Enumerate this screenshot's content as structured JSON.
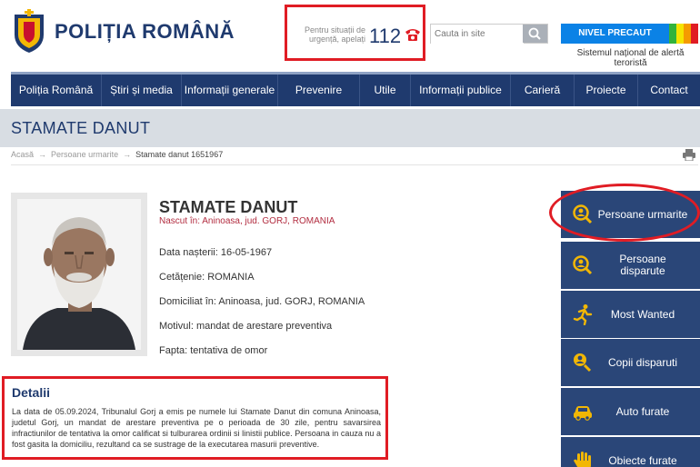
{
  "header": {
    "brand": "POLIȚIA ROMÂNĂ",
    "emergency_text": "Pentru situații de urgență, apelați",
    "emergency_number": "112",
    "search_placeholder": "Cauta in site",
    "alert_label": "NIVEL PRECAUT",
    "alert_caption": "Sistemul național de alertă teroristă",
    "alert_colors": [
      "#0b82e6",
      "#33b33b",
      "#f5e400",
      "#f59b00",
      "#e01c24"
    ]
  },
  "nav": [
    "Poliția Română",
    "Știri și media",
    "Informații generale",
    "Prevenire",
    "Utile",
    "Informații publice",
    "Carieră",
    "Proiecte",
    "Contact"
  ],
  "page_title": "STAMATE DANUT",
  "breadcrumb": {
    "home": "Acasă",
    "section": "Persoane urmarite",
    "current": "Stamate danut 1651967",
    "separator": "→"
  },
  "person": {
    "name": "STAMATE DANUT",
    "born": "Nascut în: Aninoasa, jud. GORJ, ROMANIA",
    "fields": [
      "Data nașterii: 16-05-1967",
      "Cetățenie: ROMANIA",
      "Domiciliat în: Aninoasa, jud. GORJ, ROMANIA",
      "Motivul: mandat de arestare preventiva",
      "Fapta: tentativa de omor"
    ]
  },
  "details": {
    "heading": "Detalii",
    "text": "La data de 05.09.2024, Tribunalul Gorj a emis pe numele lui Stamate Danut din comuna Aninoasa, judetul Gorj, un mandat de arestare preventiva pe o perioada de 30 zile, pentru savarsirea infractiunilor de tentativa la omor calificat si tulburarea ordinii si linistii publice. Persoana in cauza nu a fost gasita la domiciliu, rezultand ca se sustrage de la executarea masurii preventive."
  },
  "sidebar": [
    {
      "label": "Persoane urmarite",
      "icon": "search-person-icon"
    },
    {
      "label": "Persoane disparute",
      "icon": "search-person-icon"
    },
    {
      "label": "Most Wanted",
      "icon": "running-person-icon"
    },
    {
      "label": "Copii disparuti",
      "icon": "child-search-icon"
    },
    {
      "label": "Auto furate",
      "icon": "car-icon"
    },
    {
      "label": "Obiecte furate",
      "icon": "hand-icon"
    }
  ],
  "colors": {
    "navy": "#1f3a6e",
    "sidebar": "#2a4678",
    "accent_yellow": "#f2b705",
    "highlight_red": "#e01c24",
    "born_red": "#b22d40"
  }
}
